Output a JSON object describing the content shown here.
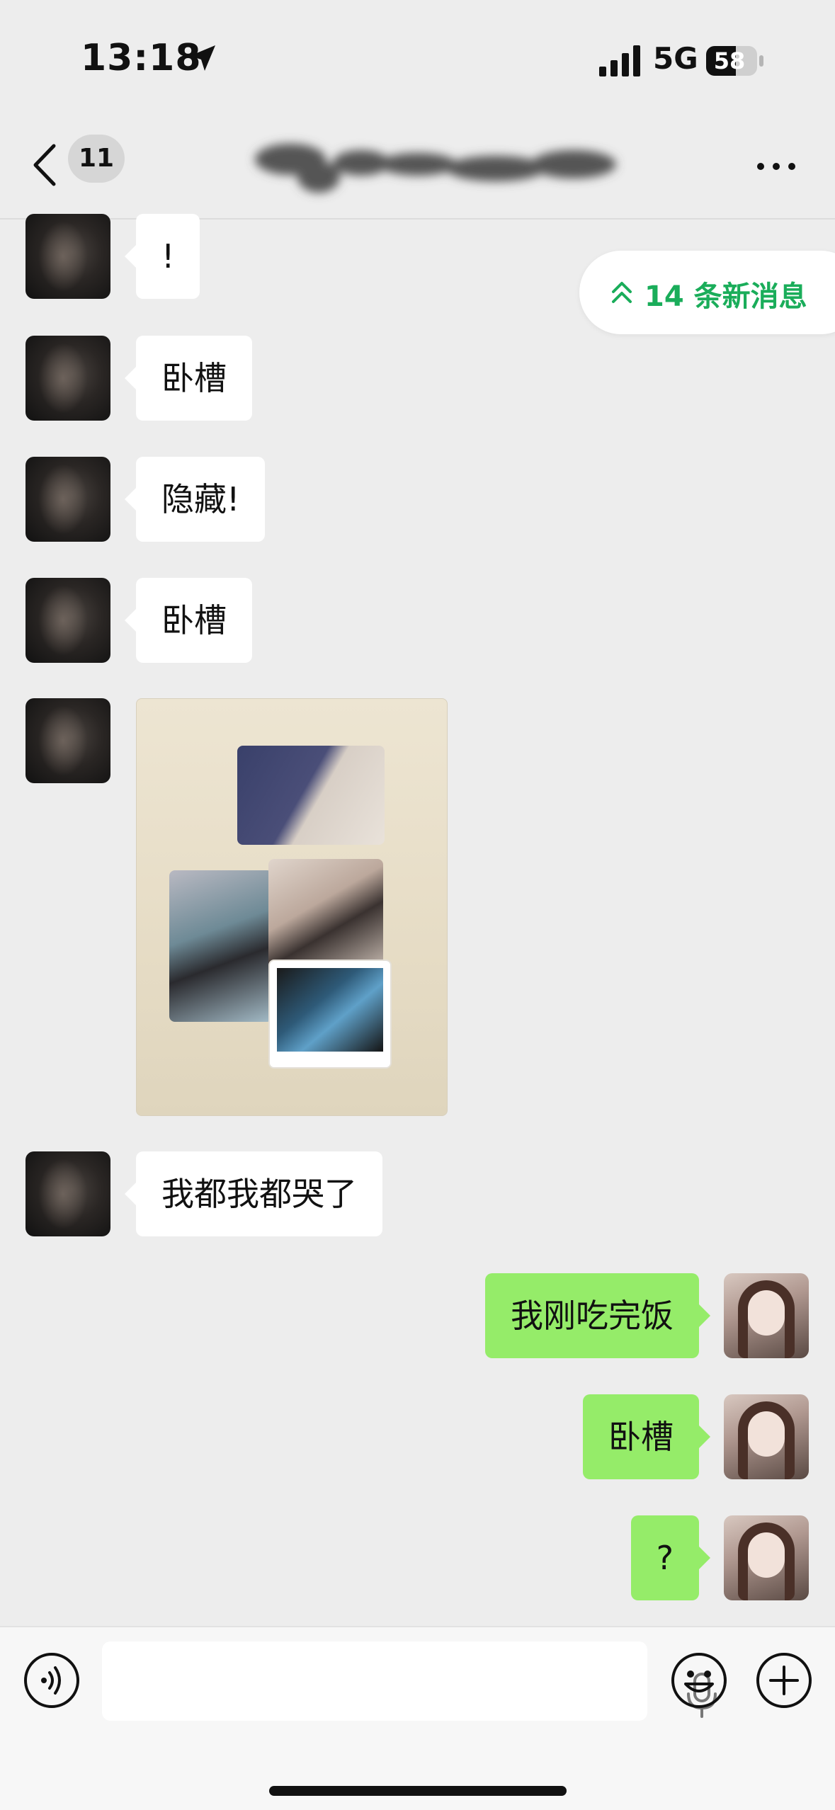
{
  "status_bar": {
    "time": "13:18",
    "network": "5G",
    "battery": "58"
  },
  "nav": {
    "unread_count": "11"
  },
  "new_messages": {
    "label": "14 条新消息"
  },
  "messages": [
    {
      "side": "in",
      "type": "text",
      "text": "!"
    },
    {
      "side": "in",
      "type": "text",
      "text": "卧槽"
    },
    {
      "side": "in",
      "type": "text",
      "text": "隐藏!"
    },
    {
      "side": "in",
      "type": "text",
      "text": "卧槽"
    },
    {
      "side": "in",
      "type": "image"
    },
    {
      "side": "in",
      "type": "text",
      "text": "我都我都哭了"
    },
    {
      "side": "out",
      "type": "text",
      "text": "我刚吃完饭"
    },
    {
      "side": "out",
      "type": "text",
      "text": "卧槽"
    },
    {
      "side": "out",
      "type": "text",
      "text": "?"
    }
  ],
  "colors": {
    "chat_background": "#ededed",
    "incoming_bubble": "#ffffff",
    "outgoing_bubble": "#95ec69",
    "accent_green": "#1aad5a"
  },
  "icons": [
    "location-arrow-icon",
    "signal-icon",
    "battery-icon",
    "back-chevron-icon",
    "more-dots-icon",
    "double-chevron-up-icon",
    "voice-icon",
    "microphone-icon",
    "emoji-icon",
    "plus-icon"
  ]
}
